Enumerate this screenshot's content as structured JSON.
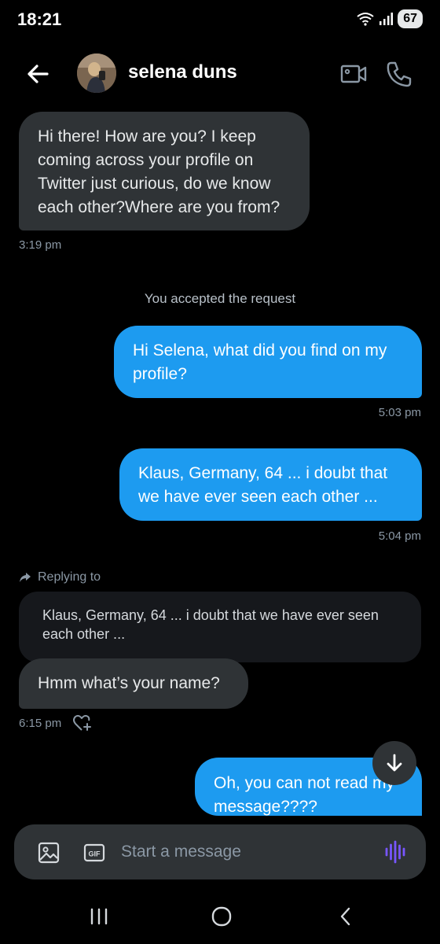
{
  "status_bar": {
    "time": "18:21",
    "battery": "67"
  },
  "header": {
    "contact_name": "selena duns"
  },
  "messages": [
    {
      "text": "Hi there! How are you? I keep coming across your profile on Twitter just curious, do we know each other?Where are you from?",
      "time": "3:19 pm"
    },
    {
      "text": "Hi Selena, what did you find on my profile?",
      "time": "5:03 pm"
    },
    {
      "text": "Klaus, Germany, 64 ... i doubt that we have ever seen each other ...",
      "time": "5:04 pm"
    },
    {
      "text": "Hmm what’s your name?",
      "time": "6:15 pm"
    },
    {
      "text": "Oh, you can not read my message????"
    }
  ],
  "system_note": "You accepted the request",
  "reply": {
    "label": "Replying to",
    "quoted_text": "Klaus, Germany, 64 ... i doubt that we have ever seen each other ..."
  },
  "composer": {
    "placeholder": "Start a message"
  },
  "icons": {
    "back": "arrow-left-icon",
    "video": "video-camera-icon",
    "call": "phone-icon",
    "photo": "image-icon",
    "gif": "gif-icon",
    "voice": "voice-wave-icon",
    "scroll": "arrow-down-icon",
    "react": "heart-plus-icon"
  },
  "colors": {
    "outgoing": "#1d9bf0",
    "incoming": "#2f3336",
    "voice": "#7856ff"
  }
}
